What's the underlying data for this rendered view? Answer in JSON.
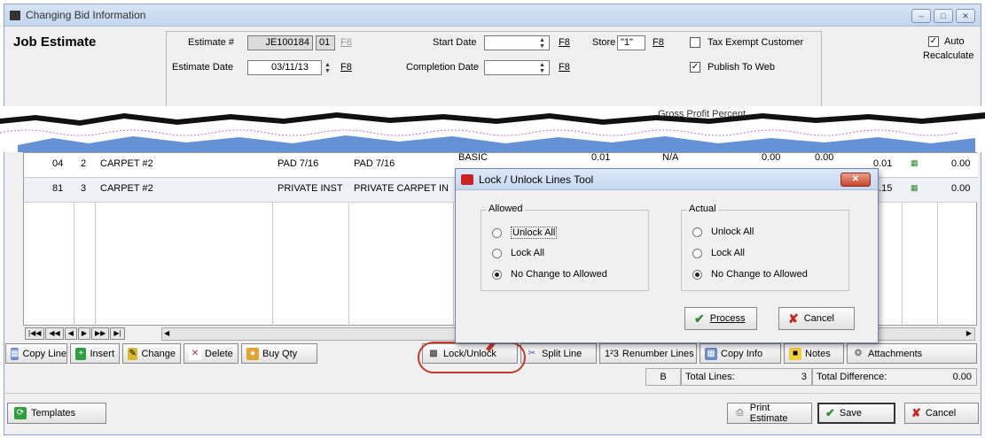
{
  "window": {
    "title": "Changing Bid Information",
    "controls": [
      "–",
      "□",
      "✕"
    ]
  },
  "header": {
    "title": "Job Estimate",
    "estimate_label": "Estimate #",
    "estimate_value": "JE100184",
    "estimate_suffix": "01",
    "f8": "F8",
    "estimate_date_label": "Estimate Date",
    "estimate_date_value": "03/11/13",
    "start_date_label": "Start Date",
    "completion_date_label": "Completion Date",
    "store_label": "Store",
    "store_value": "\"1\"",
    "tax_exempt_label": "Tax Exempt Customer",
    "tax_exempt_checked": false,
    "publish_label": "Publish To Web",
    "publish_checked": true,
    "auto_label": "Auto",
    "recalc_label": "Recalculate",
    "auto_checked": true
  },
  "torn_fragment": {
    "text": "Gross Profit Percent"
  },
  "grid": {
    "rows": [
      {
        "c1": "04",
        "c2": "2",
        "c3": "CARPET #2",
        "c4": "PAD 7/16",
        "c5": "PAD 7/16",
        "c6": "BASIC",
        "c7": "0.01",
        "c8": "N/A",
        "c9": "0.00",
        "c10": "0.00",
        "c11": "0.01",
        "c12": "0.00"
      },
      {
        "c1": "81",
        "c2": "3",
        "c3": "CARPET #2",
        "c4": "PRIVATE INST",
        "c5": "PRIVATE CARPET IN",
        "c6": "",
        "c7": "",
        "c8": "",
        "c9": "",
        "c10": "",
        "c11": "1.15",
        "c12": "0.00"
      }
    ]
  },
  "toolbar": {
    "copy_line": "Copy Line",
    "insert": "Insert",
    "change": "Change",
    "delete": "Delete",
    "buy_qty": "Buy Qty",
    "lock_unlock": "Lock/Unlock",
    "split_line": "Split Line",
    "renumber": "Renumber Lines",
    "renumber_prefix": "1²3",
    "copy_info": "Copy Info",
    "notes": "Notes",
    "attachments": "Attachments"
  },
  "status": {
    "b": "B",
    "total_lines_label": "Total Lines:",
    "total_lines_value": "3",
    "total_diff_label": "Total Difference:",
    "total_diff_value": "0.00"
  },
  "footer": {
    "templates": "Templates",
    "print": "Print Estimate",
    "save": "Save",
    "cancel": "Cancel"
  },
  "dialog": {
    "title": "Lock / Unlock Lines Tool",
    "allowed_title": "Allowed",
    "actual_title": "Actual",
    "options": [
      "Unlock All",
      "Lock All",
      "No Change to Allowed"
    ],
    "allowed_selected": 2,
    "actual_selected": 2,
    "process": "Process",
    "cancel": "Cancel",
    "close": "✕"
  },
  "colors": {
    "accent_red": "#c8382c",
    "title_blue": "#c3d6ee",
    "tear_blue": "#4a7fd0"
  }
}
